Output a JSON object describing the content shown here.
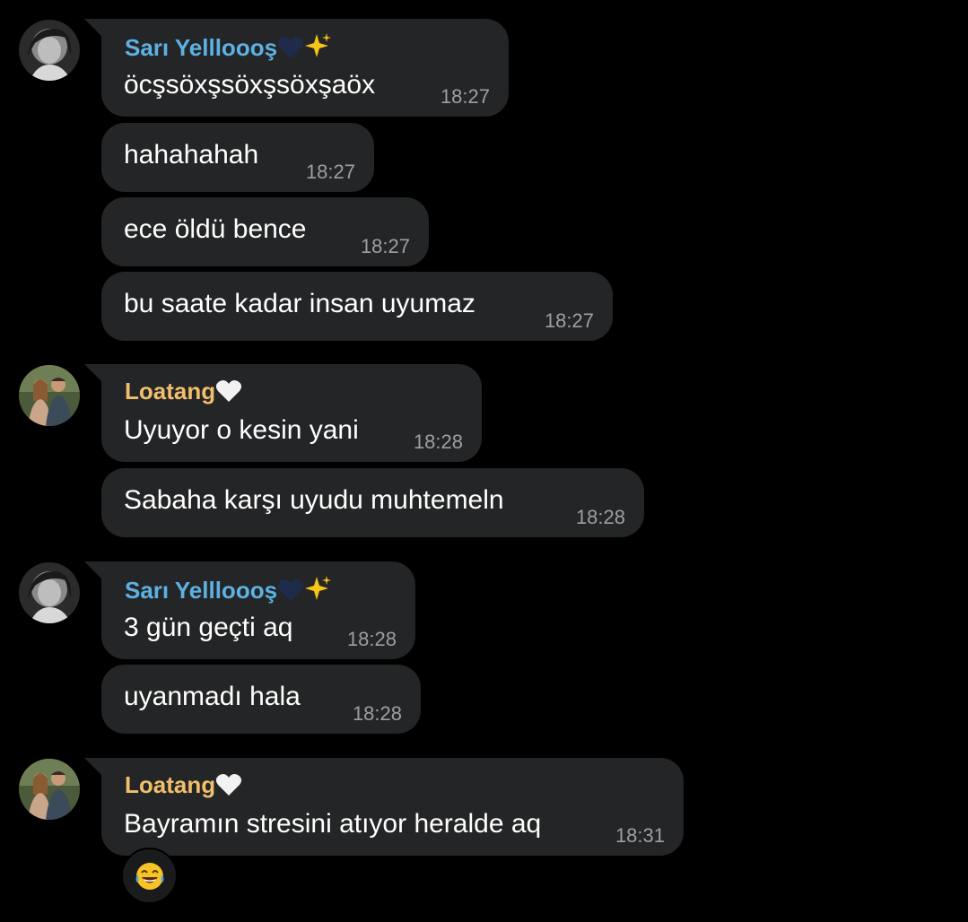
{
  "chat": {
    "senders": {
      "sari": {
        "name": "Sarı Yellloooş",
        "name_color": "#5db1e3",
        "avatar_icon": "profile-photo-grayscale-woman"
      },
      "loatang": {
        "name": "Loatang",
        "name_color": "#f0bf6c",
        "avatar_icon": "profile-photo-couple"
      }
    },
    "messages": [
      {
        "text": "öcşsöxşsöxşsöxşaöx",
        "time": "18:27"
      },
      {
        "text": "hahahahah",
        "time": "18:27"
      },
      {
        "text": "ece öldü bence",
        "time": "18:27"
      },
      {
        "text": "bu saate kadar insan uyumaz",
        "time": "18:27"
      },
      {
        "text": "Uyuyor o kesin yani",
        "time": "18:28"
      },
      {
        "text": "Sabaha karşı uyudu muhtemeln",
        "time": "18:28"
      },
      {
        "text": "3 gün geçti aq",
        "time": "18:28"
      },
      {
        "text": "uyanmadı hala",
        "time": "18:28"
      },
      {
        "text": "Bayramın stresini atıyor heralde aq",
        "time": "18:31"
      }
    ],
    "reaction": {
      "emoji": "😂",
      "icon": "tears-of-joy-emoji"
    },
    "colors": {
      "background": "#000000",
      "bubble": "#242526",
      "time": "#9d9fa3",
      "text": "#ffffff"
    }
  }
}
